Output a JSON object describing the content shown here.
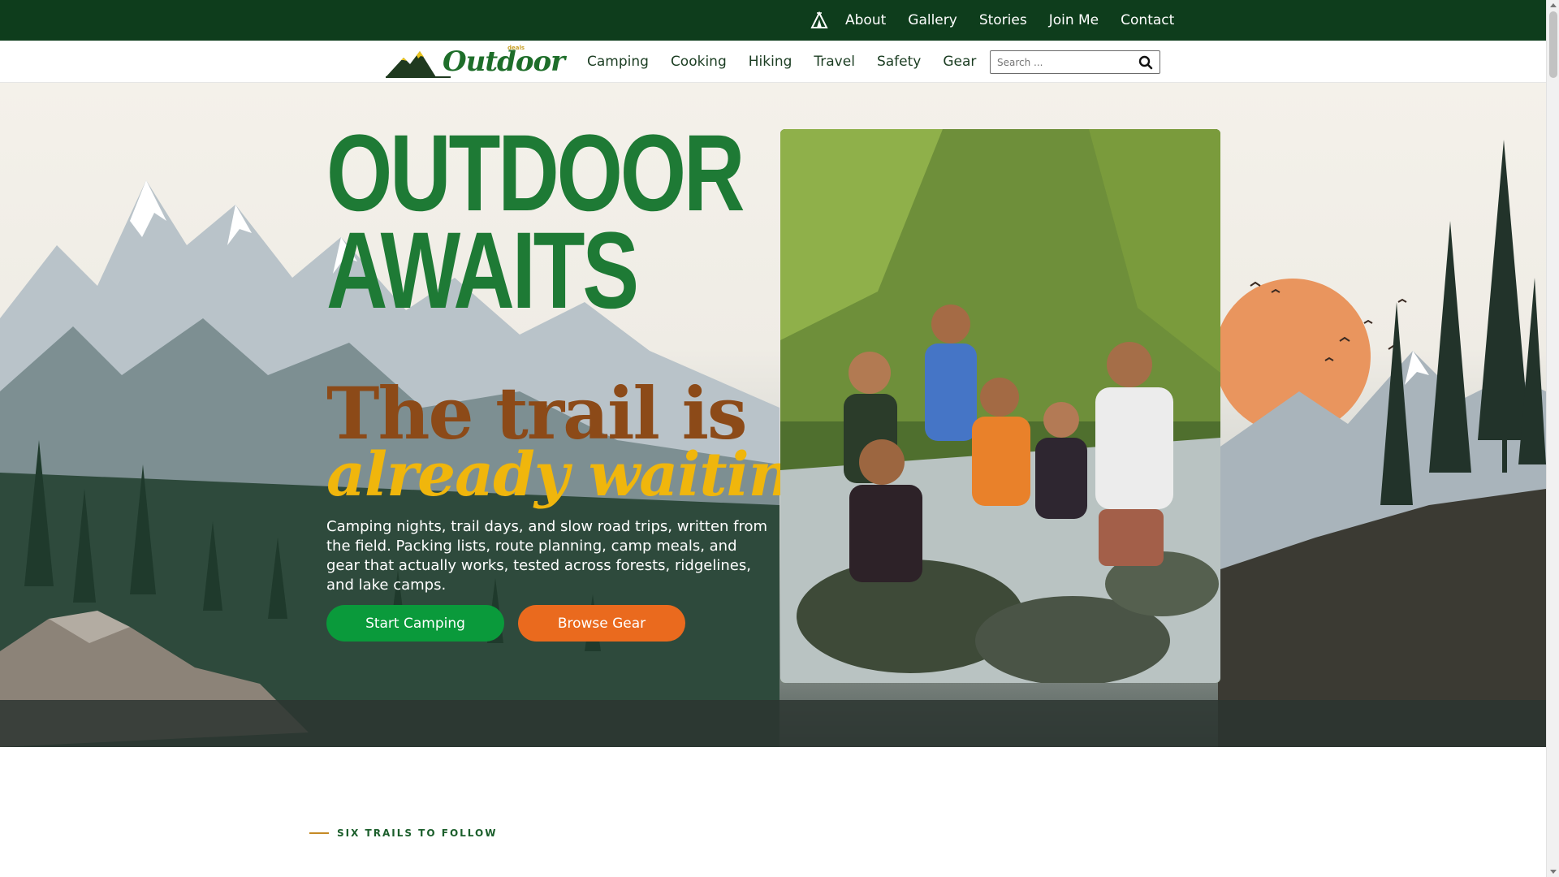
{
  "topnav": {
    "icon": "tent-icon",
    "items": [
      "About",
      "Gallery",
      "Stories",
      "Join Me",
      "Contact"
    ]
  },
  "brand": {
    "logo_text": "Outdoor",
    "logo_small": "deals"
  },
  "mainnav": {
    "items": [
      "Camping",
      "Cooking",
      "Hiking",
      "Travel",
      "Safety",
      "Gear"
    ]
  },
  "search": {
    "placeholder": "Search ...",
    "icon": "search-icon"
  },
  "hero": {
    "title_line1": "OUTDOOR",
    "title_line2": "AWAITS",
    "subtitle_line1": "The trail is",
    "subtitle_line2": "already waiting",
    "description": "Camping nights, trail days, and slow road trips, written from the field. Packing lists, route planning, camp meals, and gear that actually works, tested across forests, ridgelines, and lake camps.",
    "primary_button": "Start Camping",
    "secondary_button": "Browse Gear"
  },
  "section": {
    "label": "SIX TRAILS TO FOLLOW"
  },
  "colors": {
    "topbar": "#0e3d1c",
    "title_green": "#1e7a35",
    "subtitle_brown": "#8c4a18",
    "subtitle_yellow": "#f0b60c",
    "btn_green": "#0a9a3b",
    "btn_orange": "#ea6a1e"
  }
}
